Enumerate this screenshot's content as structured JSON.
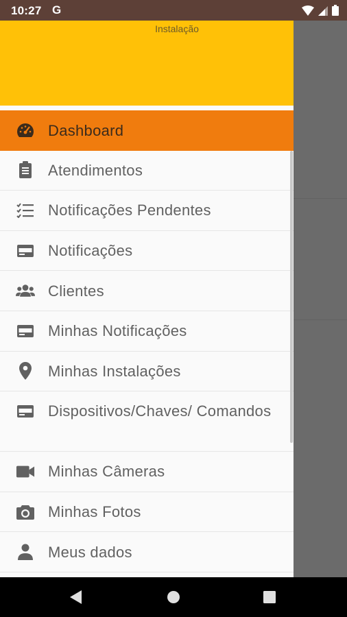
{
  "status": {
    "time": "10:27",
    "g_icon": "G"
  },
  "drawer": {
    "header_title": "Instalação",
    "header_color": "#ffc107",
    "active_color": "#f07c0e",
    "items": [
      {
        "label": "Dashboard",
        "icon": "speedometer-icon",
        "active": true
      },
      {
        "label": "Atendimentos",
        "icon": "clipboard-icon"
      },
      {
        "label": "Notificações Pendentes",
        "icon": "checklist-icon"
      },
      {
        "label": "Notificações",
        "icon": "card-icon"
      },
      {
        "label": "Clientes",
        "icon": "people-icon"
      },
      {
        "label": "Minhas Notificações",
        "icon": "card-icon"
      },
      {
        "label": "Minhas Instalações",
        "icon": "location-pin-icon"
      },
      {
        "label": "Dispositivos/Chaves/ Comandos",
        "icon": "card-icon"
      },
      {
        "label": "Minhas Câmeras",
        "icon": "videocam-icon"
      },
      {
        "label": "Minhas Fotos",
        "icon": "camera-icon"
      },
      {
        "label": "Meus dados",
        "icon": "person-icon"
      }
    ]
  },
  "nav": {
    "back": "back-icon",
    "home": "home-icon",
    "recents": "recents-icon"
  }
}
